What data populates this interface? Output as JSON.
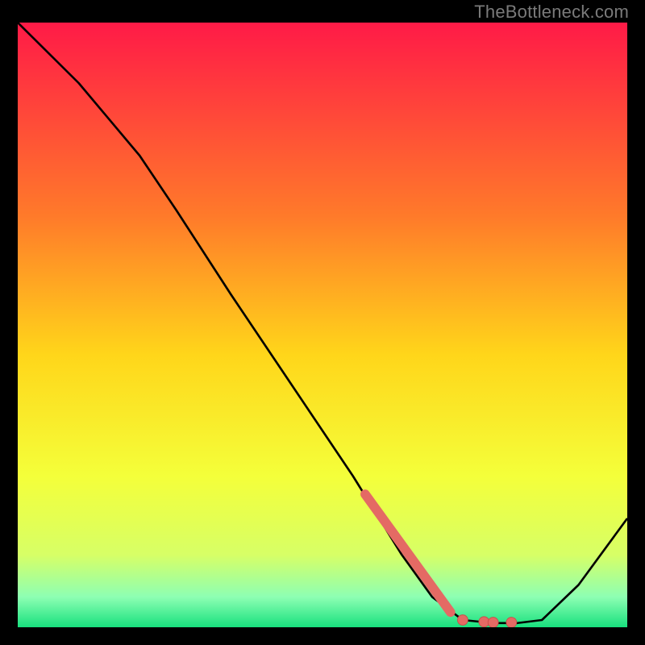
{
  "watermark": "TheBottleneck.com",
  "colors": {
    "bg_black": "#000000",
    "curve": "#000000",
    "marker_fill": "#e46a64",
    "marker_stroke": "#c94f49",
    "grad_top": "#ff1a47",
    "grad_mid1": "#ff7a2a",
    "grad_mid2": "#ffd61a",
    "grad_mid3": "#f4ff3a",
    "grad_low1": "#d7ff66",
    "grad_low2": "#8dffb3",
    "grad_bottom": "#18e07e"
  },
  "chart_data": {
    "type": "line",
    "title": "",
    "xlabel": "",
    "ylabel": "",
    "xlim": [
      0,
      100
    ],
    "ylim": [
      0,
      100
    ],
    "curve": [
      {
        "x": 0,
        "y": 100
      },
      {
        "x": 10,
        "y": 90
      },
      {
        "x": 20,
        "y": 78
      },
      {
        "x": 26,
        "y": 69
      },
      {
        "x": 35,
        "y": 55
      },
      {
        "x": 45,
        "y": 40
      },
      {
        "x": 55,
        "y": 25
      },
      {
        "x": 63,
        "y": 12
      },
      {
        "x": 68,
        "y": 5
      },
      {
        "x": 73,
        "y": 1.2
      },
      {
        "x": 78,
        "y": 0.7
      },
      {
        "x": 82,
        "y": 0.7
      },
      {
        "x": 86,
        "y": 1.2
      },
      {
        "x": 92,
        "y": 7
      },
      {
        "x": 100,
        "y": 18
      }
    ],
    "thick_segment": {
      "from": {
        "x": 57,
        "y": 22
      },
      "to": {
        "x": 71,
        "y": 2.5
      }
    },
    "dots": [
      {
        "x": 73,
        "y": 1.2
      },
      {
        "x": 76.5,
        "y": 0.9
      },
      {
        "x": 78,
        "y": 0.8
      },
      {
        "x": 81,
        "y": 0.8
      }
    ]
  }
}
